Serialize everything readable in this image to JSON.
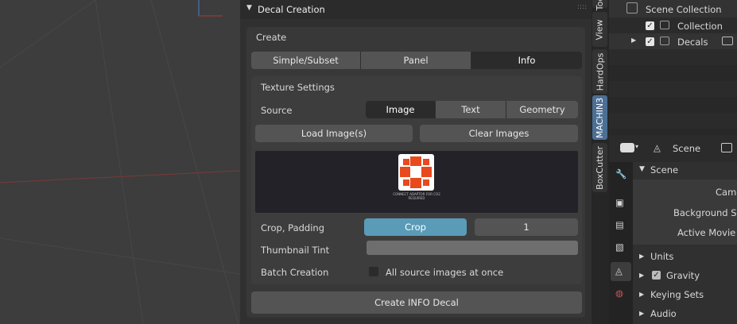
{
  "panel": {
    "title": "Decal Creation",
    "create_label": "Create",
    "modes": [
      "Simple/Subset",
      "Panel",
      "Info"
    ],
    "texture_settings": "Texture Settings",
    "source_label": "Source",
    "source_options": [
      "Image",
      "Text",
      "Geometry"
    ],
    "load_button": "Load Image(s)",
    "clear_button": "Clear Images",
    "preview_caption": "CONNECT ADAPTOR FOR CO2 REQUIRED",
    "crop_label": "Crop, Padding",
    "crop_button": "Crop",
    "padding_value": "1",
    "tint_label": "Thumbnail Tint",
    "batch_label": "Batch Creation",
    "batch_checkbox": "All source images at once",
    "create_decal_button": "Create INFO Decal"
  },
  "side_tabs": [
    "Tool",
    "View",
    "HardOps",
    "MACHIN3",
    "BoxCutter"
  ],
  "outliner": {
    "items": [
      "Scene Collection",
      "Collection",
      "Decals"
    ]
  },
  "properties": {
    "scene_selector": "Scene",
    "section": "Scene",
    "fields": [
      "Camera",
      "Background Scene",
      "Active Movie Clip"
    ],
    "subsections": [
      "Units",
      "Gravity",
      "Keying Sets",
      "Audio"
    ]
  },
  "colors": {
    "accent": "#4c6f95",
    "crop_active": "#5a9bb8",
    "preview_red": "#e84a1e"
  }
}
